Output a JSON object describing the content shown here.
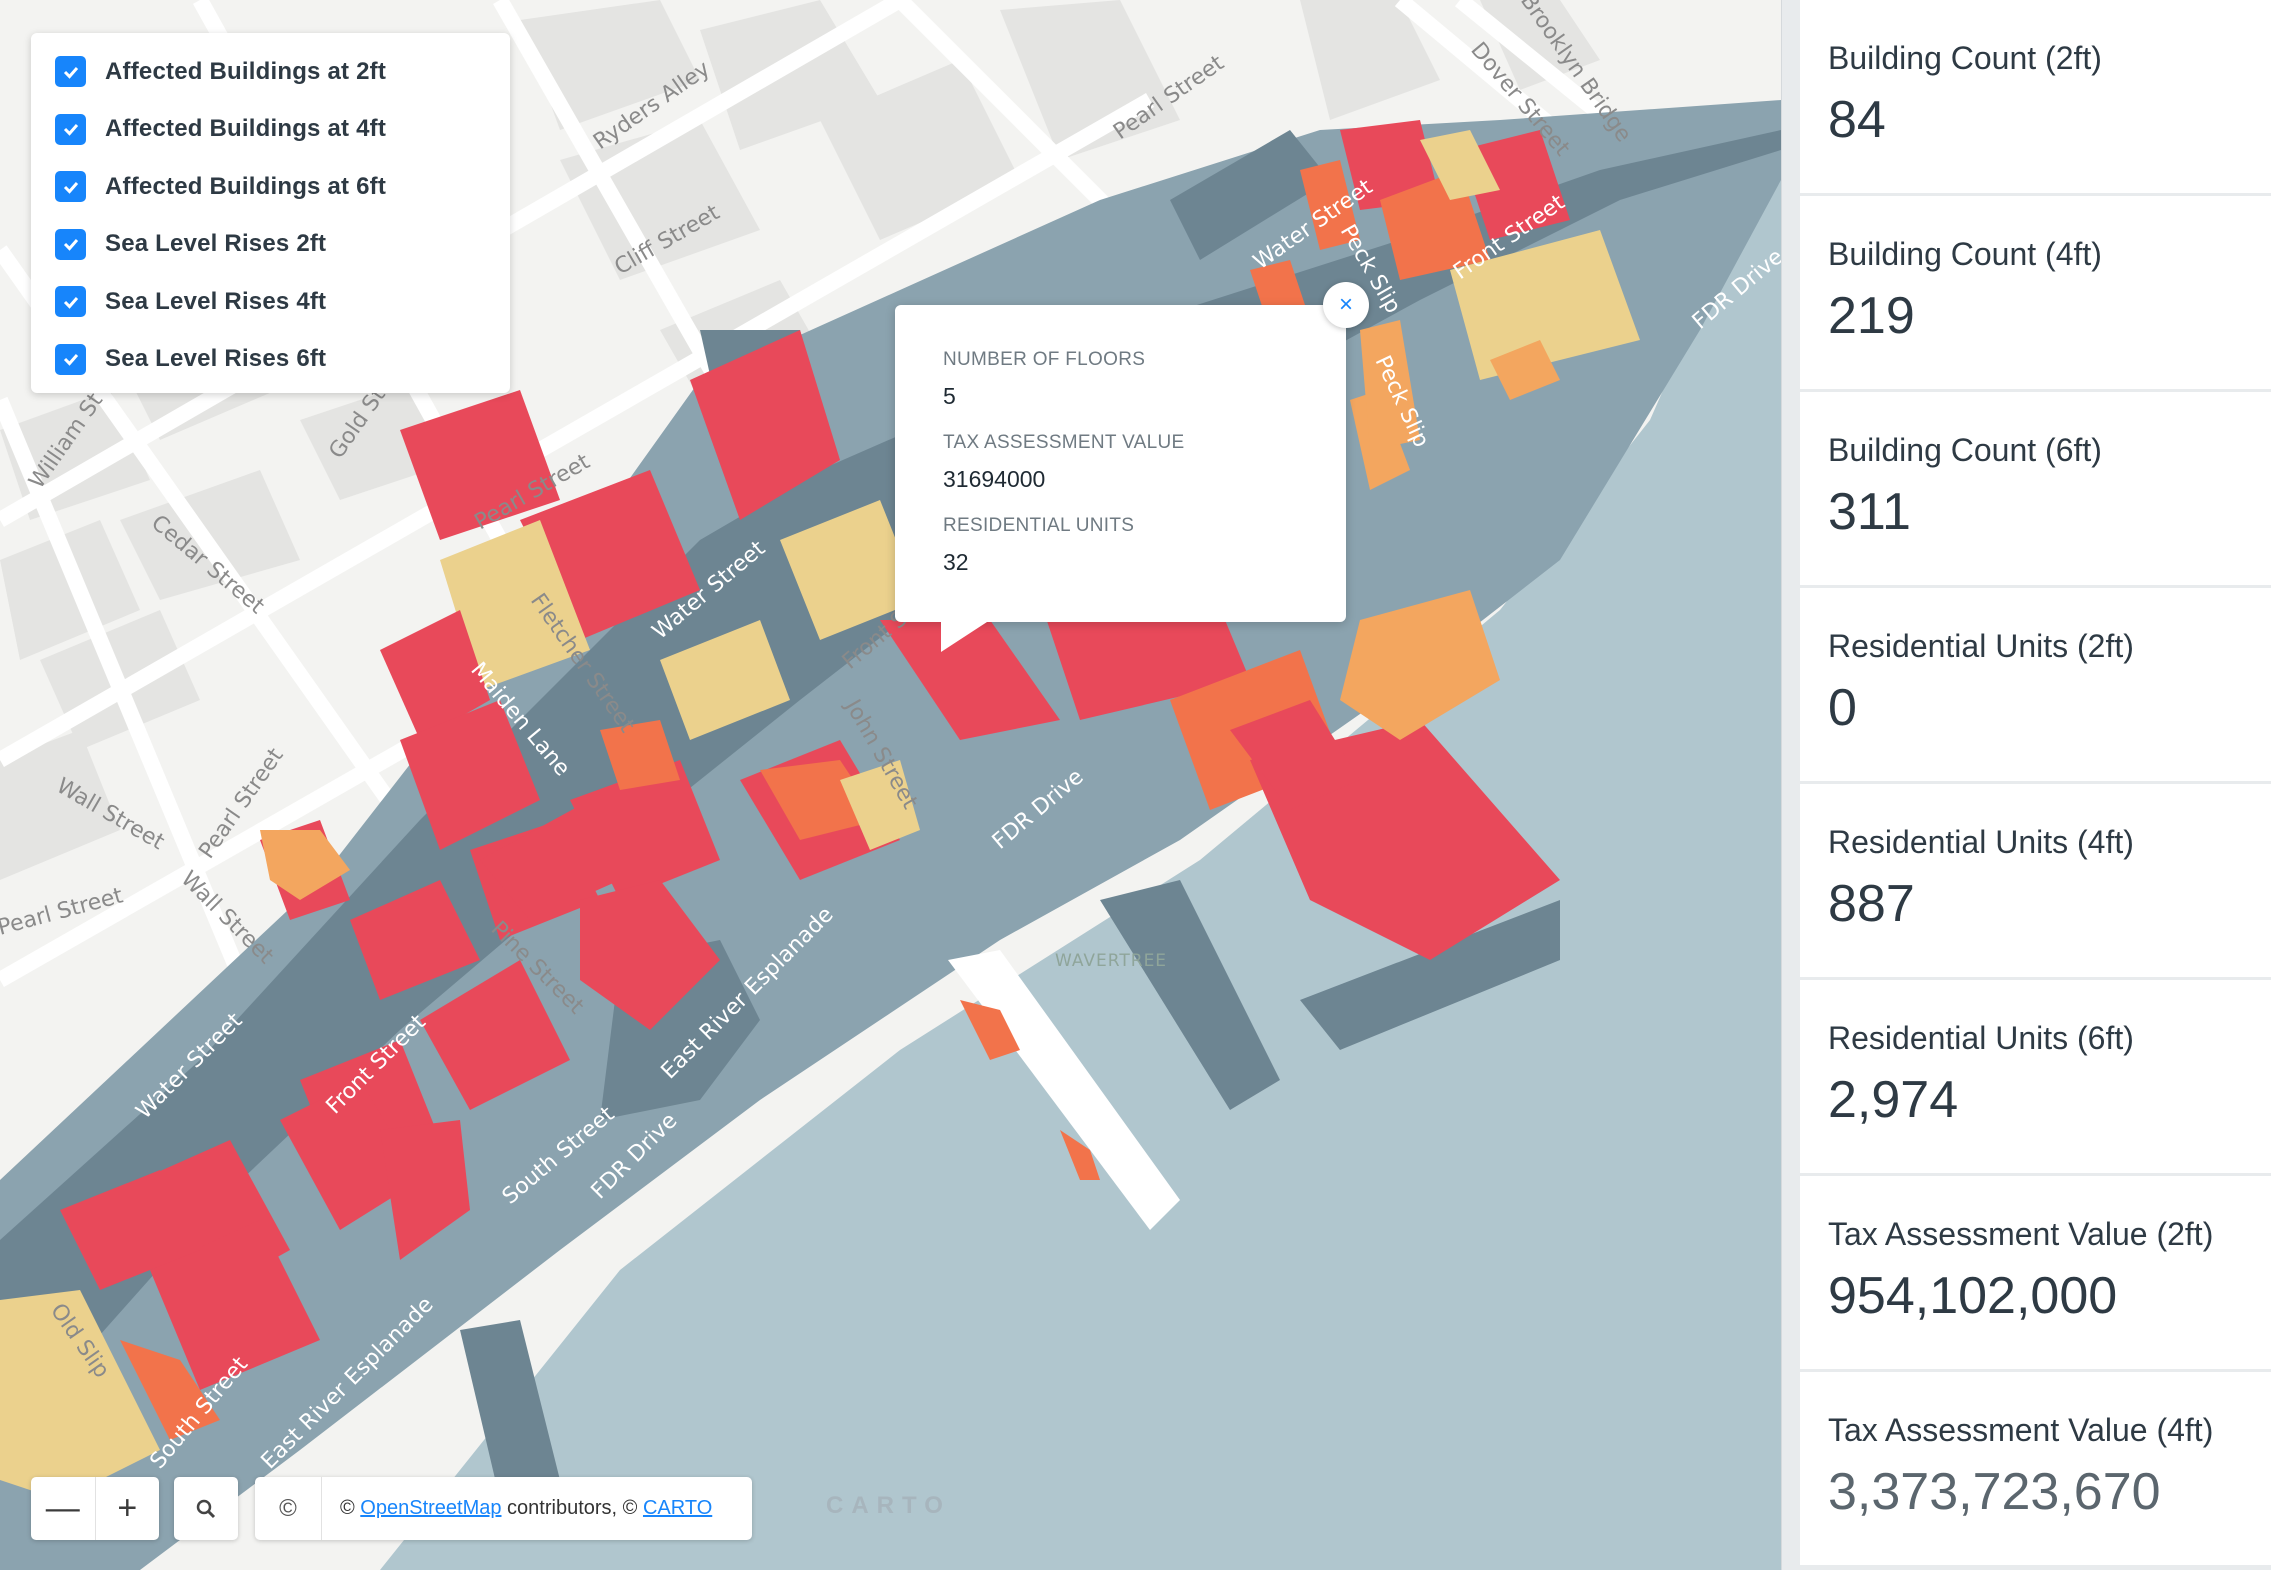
{
  "map": {
    "street_labels": [
      "Ryders Alley",
      "Cliff Street",
      "Pearl Street",
      "Dover Street",
      "Brooklyn Bridge",
      "Water Street",
      "Peck Slip",
      "Front Street",
      "South Street",
      "FDR Drive",
      "Gold St",
      "William St",
      "Cedar Street",
      "Pearl Street",
      "Water Street",
      "Fletcher Street",
      "Maiden Lane",
      "Front Street",
      "John Street",
      "FDR Drive",
      "Wall Street",
      "Pearl Street",
      "Wall Street",
      "Pine Street",
      "Water Street",
      "Front Street",
      "South Street",
      "FDR Drive",
      "East River Esplanade",
      "Old Slip",
      "South Street",
      "East River Esplanade",
      "Pearl Street",
      "Peck Slip"
    ],
    "vessel_label": "WAVERTREE",
    "colors": {
      "land": "#f3f3f1",
      "road": "#ffffff",
      "block": "#e5e5e3",
      "water": "#b0c6ce",
      "flood": "#6d8592",
      "flood_light": "#8ba3af",
      "bldg_red": "#e8495a",
      "bldg_orange": "#f2734b",
      "bldg_yellow": "#ebd18d",
      "bldg_lightorange": "#f3a65f"
    }
  },
  "layers": [
    {
      "label": "Affected Buildings at 2ft",
      "checked": true
    },
    {
      "label": "Affected Buildings at 4ft",
      "checked": true
    },
    {
      "label": "Affected Buildings at 6ft",
      "checked": true
    },
    {
      "label": "Sea Level Rises 2ft",
      "checked": true
    },
    {
      "label": "Sea Level Rises 4ft",
      "checked": true
    },
    {
      "label": "Sea Level Rises 6ft",
      "checked": true
    }
  ],
  "popup": {
    "floors_label": "NUMBER OF FLOORS",
    "floors_value": "5",
    "tax_label": "TAX ASSESSMENT VALUE",
    "tax_value": "31694000",
    "units_label": "RESIDENTIAL UNITS",
    "units_value": "32",
    "close_label": "×"
  },
  "controls": {
    "zoom_out": "—",
    "zoom_in": "+",
    "search_icon": "magnifier-icon",
    "copyright": "©",
    "attrib_prefix": "© ",
    "attrib_osm": "OpenStreetMap",
    "attrib_mid": " contributors, © ",
    "attrib_carto": "CARTO",
    "carto_logo": "CARTO"
  },
  "sidebar": {
    "cards": [
      {
        "title": "Building Count (2ft)",
        "value": "84"
      },
      {
        "title": "Building Count (4ft)",
        "value": "219"
      },
      {
        "title": "Building Count (6ft)",
        "value": "311"
      },
      {
        "title": "Residential Units (2ft)",
        "value": "0"
      },
      {
        "title": "Residential Units (4ft)",
        "value": "887"
      },
      {
        "title": "Residential Units (6ft)",
        "value": "2,974"
      },
      {
        "title": "Tax Assessment Value (2ft)",
        "value": "954,102,000"
      },
      {
        "title": "Tax Assessment Value (4ft)",
        "value": "3,373,723,670"
      }
    ]
  }
}
